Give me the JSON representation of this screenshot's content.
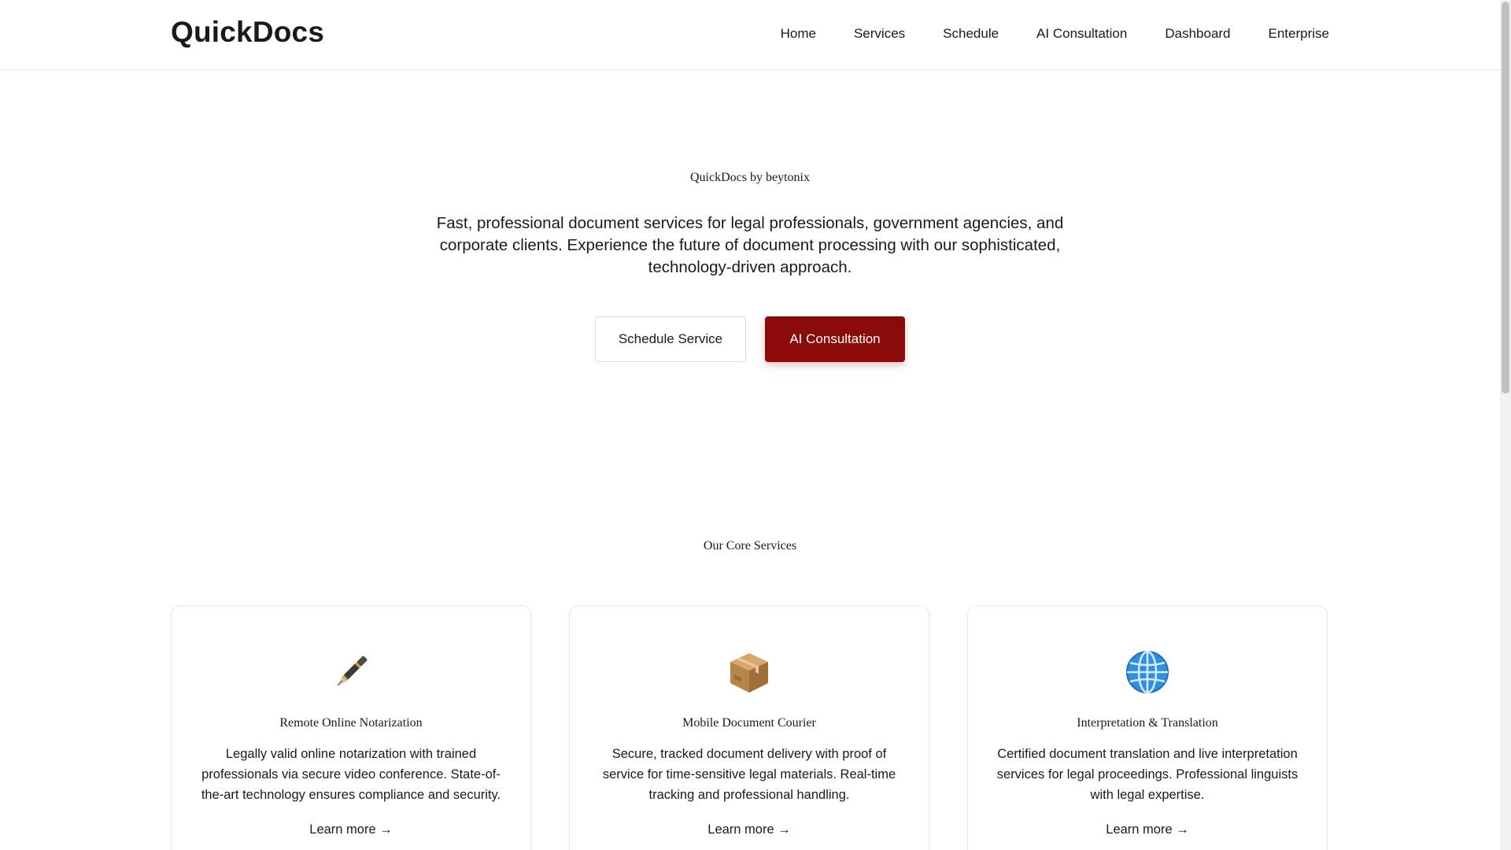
{
  "header": {
    "logo": "QuickDocs",
    "nav": [
      "Home",
      "Services",
      "Schedule",
      "AI Consultation",
      "Dashboard",
      "Enterprise"
    ]
  },
  "hero": {
    "subtitle": "QuickDocs by beytonix",
    "description": "Fast, professional document services for legal professionals, government agencies, and corporate clients. Experience the future of document processing with our sophisticated, technology-driven approach.",
    "secondary_button": "Schedule Service",
    "primary_button": "AI Consultation"
  },
  "services": {
    "title": "Our Core Services",
    "cards": [
      {
        "icon": "fountain-pen-icon",
        "title": "Remote Online Notarization",
        "description": "Legally valid online notarization with trained professionals via secure video conference. State-of-the-art technology ensures compliance and security.",
        "link": "Learn more →"
      },
      {
        "icon": "package-icon",
        "title": "Mobile Document Courier",
        "description": "Secure, tracked document delivery with proof of service for time-sensitive legal materials. Real-time tracking and professional handling.",
        "link": "Learn more →"
      },
      {
        "icon": "globe-icon",
        "title": "Interpretation & Translation",
        "description": "Certified document translation and live interpretation services for legal proceedings. Professional linguists with legal expertise.",
        "link": "Learn more →"
      }
    ]
  },
  "colors": {
    "primary": "#8b0a0a",
    "text": "#1a1a1a",
    "border": "#e6e6e6"
  }
}
